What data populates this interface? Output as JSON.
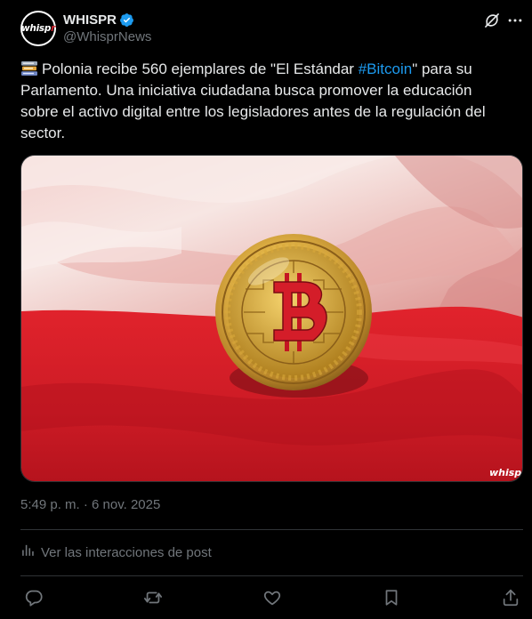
{
  "author": {
    "display_name": "WHISPR",
    "handle": "@WhisprNews",
    "avatar_text": "whisp",
    "avatar_text_accent": "r",
    "verified": true
  },
  "post": {
    "text_before": "Polonia recibe 560 ejemplares de \"El Estándar ",
    "hashtag": "#Bitcoin",
    "text_after": "\" para su Parlamento. Una iniciativa ciudadana busca promover la educación sobre el activo digital entre los legisladores antes de la regulación del sector.",
    "emoji": "books-icon",
    "media_watermark": "whisp",
    "media_watermark_accent": "r",
    "timestamp": "5:49 p. m. · 6 nov. 2025"
  },
  "analytics": {
    "label": "Ver las interacciones de post"
  },
  "icons": {
    "grok": "grok-icon",
    "more": "more-icon",
    "reply": "reply-icon",
    "repost": "repost-icon",
    "like": "like-icon",
    "bookmark": "bookmark-icon",
    "share": "share-icon",
    "analytics": "analytics-icon"
  },
  "colors": {
    "background": "#000000",
    "text": "#e7e9ea",
    "secondary": "#71767b",
    "link": "#1d9bf0",
    "verified": "#1d9bf0",
    "divider": "#2f3336",
    "flag_red": "#d4202a"
  }
}
